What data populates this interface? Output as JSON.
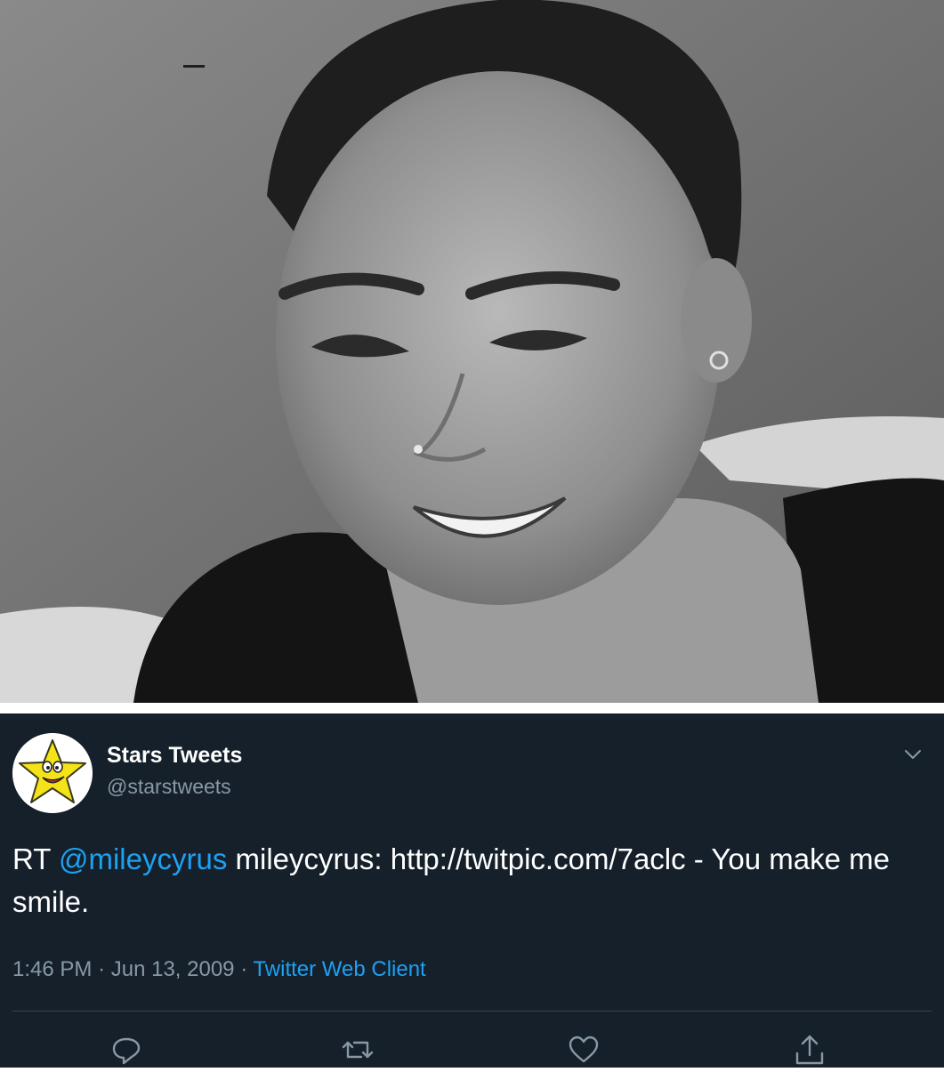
{
  "tweet": {
    "display_name": "Stars Tweets",
    "handle": "@starstweets",
    "text_prefix": "RT ",
    "mention": "@mileycyrus",
    "text_mid": " mileycyrus: ",
    "link": "http://twitpic.com/7aclc",
    "text_suffix": " - You make me smile.",
    "time": "1:46 PM",
    "separator": "·",
    "date": "Jun 13, 2009",
    "source": "Twitter Web Client"
  },
  "icons": {
    "reply": "reply-icon",
    "retweet": "retweet-icon",
    "like": "like-icon",
    "share": "share-icon",
    "caret": "chevron-down-icon",
    "avatar": "star-mascot-avatar"
  },
  "colors": {
    "background": "#15202b",
    "accent": "#1da1f2",
    "secondary_text": "#8899a6",
    "divider": "#38444d"
  }
}
